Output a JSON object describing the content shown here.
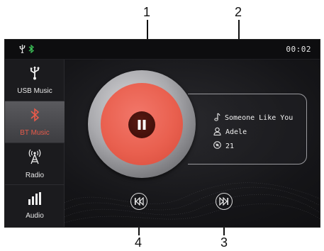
{
  "callouts": {
    "one": "1",
    "two": "2",
    "three": "3",
    "four": "4"
  },
  "status": {
    "time": "00:02"
  },
  "sidebar": {
    "items": [
      {
        "label": "USB Music",
        "icon": "usb-icon"
      },
      {
        "label": "BT Music",
        "icon": "bluetooth-icon",
        "active": true
      },
      {
        "label": "Radio",
        "icon": "radio-tower-icon"
      },
      {
        "label": "Audio",
        "icon": "equalizer-icon"
      }
    ]
  },
  "track": {
    "title": "Someone Like You",
    "artist": "Adele",
    "number": "21"
  },
  "colors": {
    "accent": "#e85a4a",
    "disc": "#e9604f",
    "background": "#151518"
  }
}
